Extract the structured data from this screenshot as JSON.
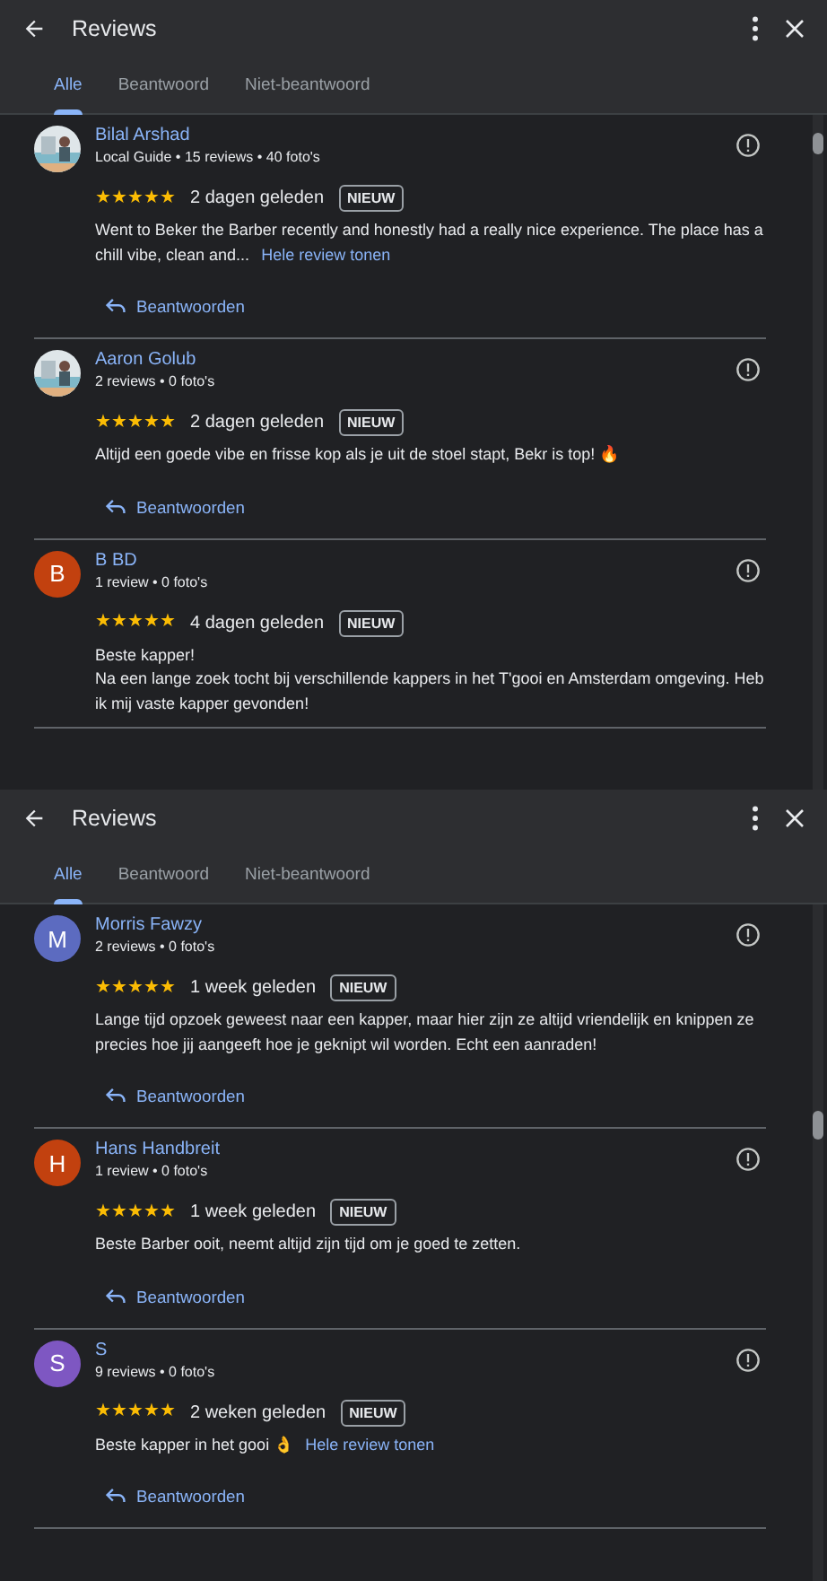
{
  "panels": [
    {
      "title": "Reviews",
      "tabs": [
        {
          "label": "Alle",
          "selected": true
        },
        {
          "label": "Beantwoord",
          "selected": false
        },
        {
          "label": "Niet-beantwoord",
          "selected": false
        }
      ],
      "reviews": [
        {
          "name": "Bilal Arshad",
          "meta": "Local Guide • 15 reviews • 40 foto's",
          "stars": 5,
          "time": "2 dagen geleden",
          "badge": "NIEUW",
          "text": "Went to Beker the Barber recently and honestly had a really nice experience. The place has a chill vibe, clean and...",
          "more": "Hele review tonen",
          "reply": "Beantwoorden"
        },
        {
          "name": "Aaron Golub",
          "meta": "2 reviews • 0 foto's",
          "stars": 5,
          "time": "2 dagen geleden",
          "badge": "NIEUW",
          "text": "Altijd een goede vibe en frisse kop als je uit de stoel stapt, Bekr is top! 🔥",
          "reply": "Beantwoorden"
        },
        {
          "name": "B BD",
          "avatar": {
            "kind": "letter",
            "letter": "B",
            "color": "#c2410f"
          },
          "meta": "1 review • 0 foto's",
          "stars": 5,
          "time": "4 dagen geleden",
          "badge": "NIEUW",
          "text": "Beste kapper!\nNa een lange zoek tocht bij verschillende kappers in het T'gooi en Amsterdam omgeving. Heb ik mij vaste kapper gevonden!"
        }
      ]
    },
    {
      "title": "Reviews",
      "tabs": [
        {
          "label": "Alle",
          "selected": true
        },
        {
          "label": "Beantwoord",
          "selected": false
        },
        {
          "label": "Niet-beantwoord",
          "selected": false
        }
      ],
      "reviews": [
        {
          "name": "Morris Fawzy",
          "avatar": {
            "kind": "letter",
            "letter": "M",
            "color": "#5c6bc0"
          },
          "meta": "2 reviews • 0 foto's",
          "stars": 5,
          "time": "1 week geleden",
          "badge": "NIEUW",
          "text": "Lange tijd opzoek geweest naar een kapper, maar hier zijn ze altijd vriendelijk en knippen ze precies hoe jij aangeeft hoe je geknipt wil worden. Echt een aanraden!",
          "reply": "Beantwoorden"
        },
        {
          "name": "Hans Handbreit",
          "avatar": {
            "kind": "letter",
            "letter": "H",
            "color": "#c2410f"
          },
          "meta": "1 review • 0 foto's",
          "stars": 5,
          "time": "1 week geleden",
          "badge": "NIEUW",
          "text": "Beste Barber ooit, neemt altijd zijn tijd om je goed te zetten.",
          "reply": "Beantwoorden"
        },
        {
          "name": "S",
          "avatar": {
            "kind": "letter",
            "letter": "S",
            "color": "#7e57c2"
          },
          "meta": "9 reviews • 0 foto's",
          "stars": 5,
          "time": "2 weken geleden",
          "badge": "NIEUW",
          "text": "Beste kapper in het gooi 👌",
          "more": "Hele review tonen",
          "reply": "Beantwoorden"
        }
      ]
    }
  ]
}
